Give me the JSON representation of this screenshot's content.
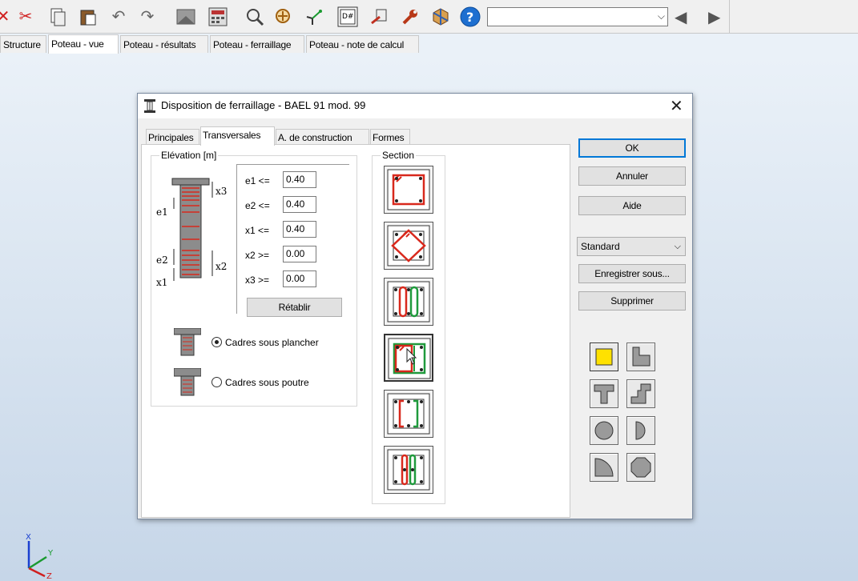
{
  "toolbar": {
    "icons": [
      "scissors-icon",
      "copy-icon",
      "paste-icon",
      "undo-icon",
      "redo-icon",
      "image-icon",
      "calculator-icon",
      "zoom-icon",
      "zoom-extents-icon",
      "graph-icon",
      "table-icon",
      "export-icon",
      "wrench-icon",
      "3d-icon",
      "help-icon"
    ],
    "combo_value": "",
    "colors": {
      "cut": "#d02020",
      "help": "#1e6fd0"
    }
  },
  "main_tabs": [
    {
      "label": "Structure"
    },
    {
      "label": "Poteau - vue",
      "active": true
    },
    {
      "label": "Poteau - résultats"
    },
    {
      "label": "Poteau - ferraillage"
    },
    {
      "label": "Poteau - note de calcul"
    }
  ],
  "dialog": {
    "title": "Disposition de ferraillage - BAEL 91 mod. 99",
    "tabs": [
      {
        "label": "Principales"
      },
      {
        "label": "Transversales",
        "active": true
      },
      {
        "label": "A. de construction"
      },
      {
        "label": "Formes"
      }
    ],
    "elevation": {
      "legend": "Elévation [m]",
      "diagram_labels": {
        "x3": "x3",
        "e1": "e1",
        "e2": "e2",
        "x2": "x2",
        "x1": "x1"
      },
      "fields": [
        {
          "label": "e1 <=",
          "value": "0.40"
        },
        {
          "label": "e2 <=",
          "value": "0.40"
        },
        {
          "label": "x1 <=",
          "value": "0.40"
        },
        {
          "label": "x2 >=",
          "value": "0.00"
        },
        {
          "label": "x3 >=",
          "value": "0.00"
        }
      ],
      "reset_label": "Rétablir",
      "options": [
        {
          "label": "Cadres sous plancher",
          "checked": true
        },
        {
          "label": "Cadres sous poutre",
          "checked": false
        }
      ]
    },
    "section": {
      "legend": "Section"
    },
    "buttons": {
      "ok": "OK",
      "cancel": "Annuler",
      "help": "Aide"
    },
    "preset": {
      "value": "Standard",
      "save": "Enregistrer sous...",
      "delete": "Supprimer"
    },
    "shape_icons": [
      "rectangle-shape-icon",
      "l-shape-icon",
      "t-shape-icon",
      "z-shape-icon",
      "circle-shape-icon",
      "half-circle-shape-icon",
      "quarter-circle-shape-icon",
      "octagon-shape-icon"
    ],
    "colors": {
      "stirrup": "#d8281c",
      "stirrup_alt": "#1f9a3c",
      "selected_shape": "#ffe100"
    }
  },
  "axes": {
    "x": "X",
    "y": "Y",
    "z": "Z"
  }
}
